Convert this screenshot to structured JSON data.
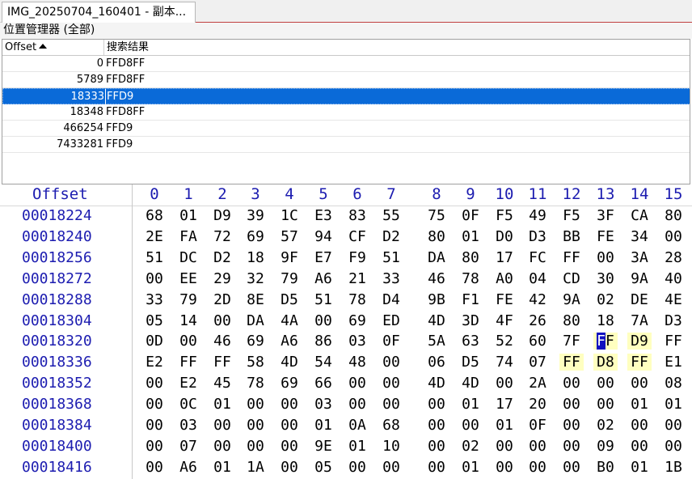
{
  "tab": {
    "title": "IMG_20250704_160401 - 副本..."
  },
  "panel": {
    "title": "位置管理器 (全部)"
  },
  "results": {
    "col_offset": "Offset",
    "col_result": "搜索结果",
    "rows": [
      {
        "offset": "0",
        "value": "FFD8FF"
      },
      {
        "offset": "5789",
        "value": "FFD8FF"
      },
      {
        "offset": "18333",
        "value": "FFD9"
      },
      {
        "offset": "18348",
        "value": "FFD8FF"
      },
      {
        "offset": "466254",
        "value": "FFD9"
      },
      {
        "offset": "7433281",
        "value": "FFD9"
      }
    ],
    "selected_index": 2
  },
  "hex": {
    "offset_header": "Offset",
    "columns": [
      "0",
      "1",
      "2",
      "3",
      "4",
      "5",
      "6",
      "7",
      "8",
      "9",
      "10",
      "11",
      "12",
      "13",
      "14",
      "15"
    ],
    "rows": [
      {
        "offset": "00018224",
        "bytes": [
          "68",
          "01",
          "D9",
          "39",
          "1C",
          "E3",
          "83",
          "55",
          "75",
          "0F",
          "F5",
          "49",
          "F5",
          "3F",
          "CA",
          "80"
        ]
      },
      {
        "offset": "00018240",
        "bytes": [
          "2E",
          "FA",
          "72",
          "69",
          "57",
          "94",
          "CF",
          "D2",
          "80",
          "01",
          "D0",
          "D3",
          "BB",
          "FE",
          "34",
          "00"
        ]
      },
      {
        "offset": "00018256",
        "bytes": [
          "51",
          "DC",
          "D2",
          "18",
          "9F",
          "E7",
          "F9",
          "51",
          "DA",
          "80",
          "17",
          "FC",
          "FF",
          "00",
          "3A",
          "28"
        ]
      },
      {
        "offset": "00018272",
        "bytes": [
          "00",
          "EE",
          "29",
          "32",
          "79",
          "A6",
          "21",
          "33",
          "46",
          "78",
          "A0",
          "04",
          "CD",
          "30",
          "9A",
          "40"
        ]
      },
      {
        "offset": "00018288",
        "bytes": [
          "33",
          "79",
          "2D",
          "8E",
          "D5",
          "51",
          "78",
          "D4",
          "9B",
          "F1",
          "FE",
          "42",
          "9A",
          "02",
          "DE",
          "4E"
        ]
      },
      {
        "offset": "00018304",
        "bytes": [
          "05",
          "14",
          "00",
          "DA",
          "4A",
          "00",
          "69",
          "ED",
          "4D",
          "3D",
          "4F",
          "26",
          "80",
          "18",
          "7A",
          "D3"
        ]
      },
      {
        "offset": "00018320",
        "bytes": [
          "0D",
          "00",
          "46",
          "69",
          "A6",
          "86",
          "03",
          "0F",
          "5A",
          "63",
          "52",
          "60",
          "7F",
          "FF",
          "D9",
          "FF"
        ]
      },
      {
        "offset": "00018336",
        "bytes": [
          "E2",
          "FF",
          "FF",
          "58",
          "4D",
          "54",
          "48",
          "00",
          "06",
          "D5",
          "74",
          "07",
          "FF",
          "D8",
          "FF",
          "E1"
        ]
      },
      {
        "offset": "00018352",
        "bytes": [
          "00",
          "E2",
          "45",
          "78",
          "69",
          "66",
          "00",
          "00",
          "4D",
          "4D",
          "00",
          "2A",
          "00",
          "00",
          "00",
          "08"
        ]
      },
      {
        "offset": "00018368",
        "bytes": [
          "00",
          "0C",
          "01",
          "00",
          "00",
          "03",
          "00",
          "00",
          "00",
          "01",
          "17",
          "20",
          "00",
          "00",
          "01",
          "01"
        ]
      },
      {
        "offset": "00018384",
        "bytes": [
          "00",
          "03",
          "00",
          "00",
          "00",
          "01",
          "0A",
          "68",
          "00",
          "00",
          "01",
          "0F",
          "00",
          "02",
          "00",
          "00"
        ]
      },
      {
        "offset": "00018400",
        "bytes": [
          "00",
          "07",
          "00",
          "00",
          "00",
          "9E",
          "01",
          "10",
          "00",
          "02",
          "00",
          "00",
          "00",
          "09",
          "00",
          "00"
        ]
      },
      {
        "offset": "00018416",
        "bytes": [
          "00",
          "A6",
          "01",
          "1A",
          "00",
          "05",
          "00",
          "00",
          "00",
          "01",
          "00",
          "00",
          "00",
          "B0",
          "01",
          "1B"
        ]
      }
    ],
    "highlight": [
      {
        "row": 6,
        "col": 13,
        "cursor": true
      },
      {
        "row": 6,
        "col": 14
      },
      {
        "row": 7,
        "col": 12
      },
      {
        "row": 7,
        "col": 13
      },
      {
        "row": 7,
        "col": 14
      }
    ]
  }
}
